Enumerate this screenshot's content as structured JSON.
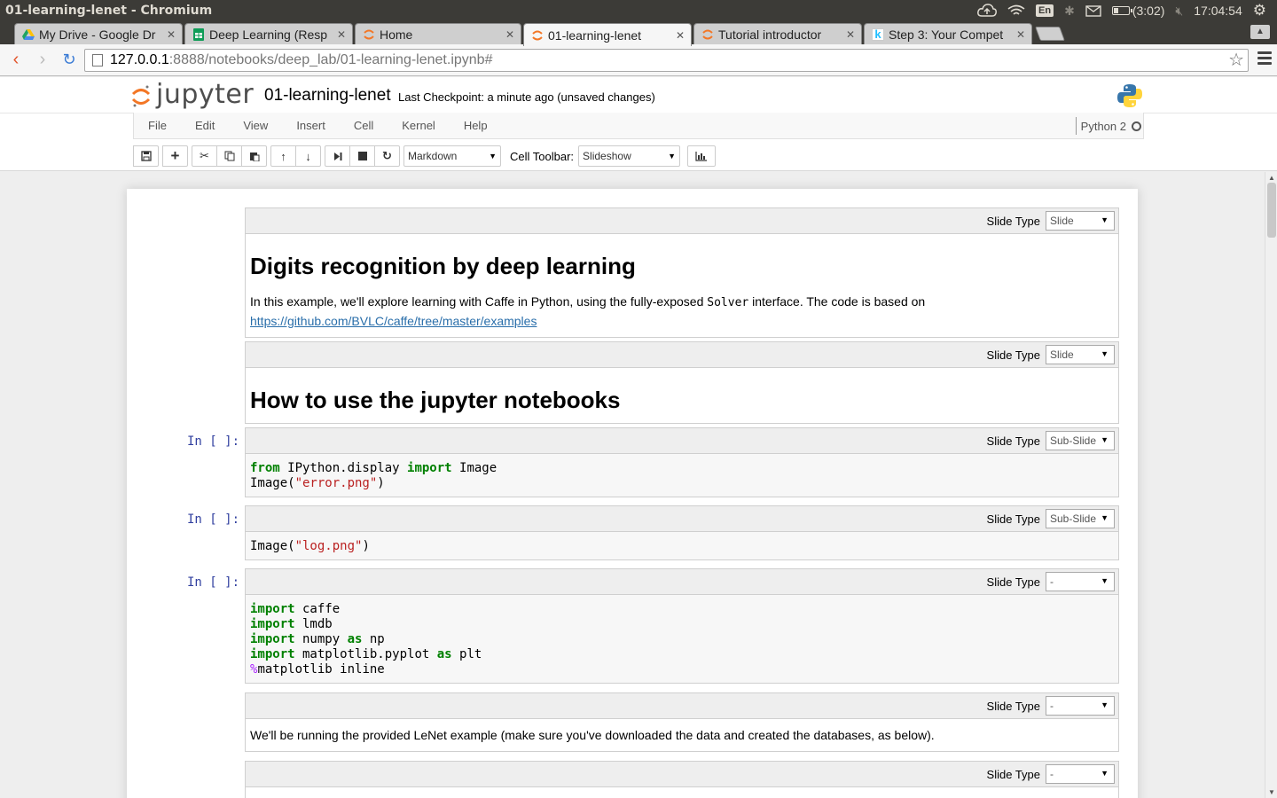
{
  "os_panel": {
    "window_title": "01-learning-lenet - Chromium",
    "language": "En",
    "battery": "(3:02)",
    "clock": "17:04:54"
  },
  "browser": {
    "tabs": [
      {
        "label": "My Drive - Google Dr",
        "icon": "google-drive-icon",
        "active": false
      },
      {
        "label": "Deep Learning (Resp",
        "icon": "google-sheets-icon",
        "active": false
      },
      {
        "label": "Home",
        "icon": "jupyter-icon",
        "active": false
      },
      {
        "label": "01-learning-lenet",
        "icon": "jupyter-icon",
        "active": true
      },
      {
        "label": "Tutorial introductor",
        "icon": "jupyter-icon",
        "active": false
      },
      {
        "label": "Step 3: Your Compet",
        "icon": "kaggle-icon",
        "active": false
      }
    ],
    "url_host": "127.0.0.1",
    "url_path": ":8888/notebooks/deep_lab/01-learning-lenet.ipynb#"
  },
  "jupyter": {
    "logo_text": "jupyter",
    "notebook_name": "01-learning-lenet",
    "checkpoint": "Last Checkpoint: a minute ago (unsaved changes)",
    "menu": [
      "File",
      "Edit",
      "View",
      "Insert",
      "Cell",
      "Kernel",
      "Help"
    ],
    "kernel_name": "Python 2",
    "cell_type_select": "Markdown",
    "cell_toolbar_label": "Cell Toolbar:",
    "cell_toolbar_select": "Slideshow"
  },
  "cells": {
    "slide_type_label": "Slide Type",
    "c1": {
      "slide_type": "Slide",
      "heading": "Digits recognition by deep learning",
      "text_before": "In this example, we'll explore learning with Caffe in Python, using the fully-exposed ",
      "code_word": "Solver",
      "text_after": " interface. The code is based on",
      "link": "https://github.com/BVLC/caffe/tree/master/examples"
    },
    "c2": {
      "slide_type": "Slide",
      "heading": "How to use the jupyter notebooks"
    },
    "c3": {
      "prompt": "In [ ]:",
      "slide_type": "Sub-Slide",
      "l1_kw1": "from",
      "l1_mod": " IPython.display ",
      "l1_kw2": "import",
      "l1_name": " Image",
      "l2_fn": "Image(",
      "l2_str": "\"error.png\"",
      "l2_end": ")"
    },
    "c4": {
      "prompt": "In [ ]:",
      "slide_type": "Sub-Slide",
      "l1_fn": "Image(",
      "l1_str": "\"log.png\"",
      "l1_end": ")"
    },
    "c5": {
      "prompt": "In [ ]:",
      "slide_type": "-",
      "kw_import": "import",
      "kw_as": "as",
      "l1": " caffe",
      "l2": " lmdb",
      "l3a": " numpy ",
      "l3b": " np",
      "l4a": " matplotlib.pyplot ",
      "l4b": " plt",
      "l5_pct": "%",
      "l5": "matplotlib inline"
    },
    "c6": {
      "slide_type": "-",
      "text": "We'll be running the provided LeNet example (make sure you've downloaded the data and created the databases, as below)."
    },
    "c7": {
      "slide_type": "-"
    }
  }
}
